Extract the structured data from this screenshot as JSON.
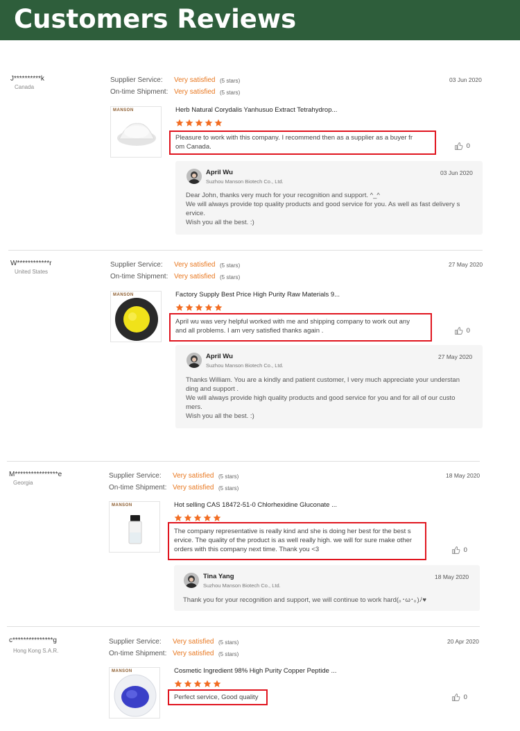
{
  "banner": {
    "title": "Customers Reviews"
  },
  "labels": {
    "supplier_service": "Supplier Service:",
    "ontime_shipment": "On-time Shipment:"
  },
  "colors": {
    "banner_bg": "#2e5e3b",
    "satisfied": "#e8771f",
    "star": "#f26c21",
    "highlight_box": "#e0141e"
  },
  "reviews": [
    {
      "reviewer": "J**********k",
      "country": "Canada",
      "supplier_service": "Very satisfied",
      "supplier_stars": "(5 stars)",
      "ontime_shipment": "Very satisfied",
      "ontime_stars": "(5 stars)",
      "date": "03 Jun 2020",
      "brand": "MANSON",
      "product_title": "Herb Natural Corydalis Yanhusuo Extract Tetrahydrop...",
      "rating": 5,
      "comment_lines": [
        "Pleasure to work with this company.  I recommend then as a supplier as a buyer fr",
        "om Canada."
      ],
      "likes": "0",
      "reply": {
        "name": "April Wu",
        "company": "Suzhou Manson Biotech Co., Ltd.",
        "date": "03 Jun 2020",
        "lines": [
          "Dear John, thanks very much for your recognition and support. ^_^",
          "We will always provide top quality products and good service for you. As well as fast delivery s",
          "ervice.",
          "Wish you all the best. :)"
        ]
      }
    },
    {
      "reviewer": "W************r",
      "country": "United States",
      "supplier_service": "Very satisfied",
      "supplier_stars": "(5 stars)",
      "ontime_shipment": "Very satisfied",
      "ontime_stars": "(5 stars)",
      "date": "27 May 2020",
      "brand": "MANSON",
      "product_title": "Factory Supply Best Price High Purity Raw Materials 9...",
      "rating": 5,
      "comment_lines": [
        "April wu was very helpful worked with me and shipping company to work out any",
        "and all problems.  I am very satisfied  thanks again ."
      ],
      "likes": "0",
      "reply": {
        "name": "April Wu",
        "company": "Suzhou Manson Biotech Co., Ltd.",
        "date": "27 May 2020",
        "lines": [
          "Thanks William. You are a kindly and patient customer, I very much appreciate your understan",
          "ding and support .",
          "We will always provide high quality products and good service for you and for all of our custo",
          "mers.",
          "Wish you all the best. :)"
        ]
      }
    },
    {
      "reviewer": "M****************e",
      "country": "Georgia",
      "supplier_service": "Very satisfied",
      "supplier_stars": "(5 stars)",
      "ontime_shipment": "Very satisfied",
      "ontime_stars": "(5 stars)",
      "date": "18 May 2020",
      "brand": "MANSON",
      "product_title": "Hot selling CAS 18472-51-0 Chlorhexidine Gluconate ...",
      "rating": 5,
      "comment_lines": [
        "The company representative is really kind and she is doing her best for the best s",
        "ervice. The quality of the product is as well really high. we will for sure make other",
        "orders with this company next time. Thank you <3"
      ],
      "likes": "0",
      "reply": {
        "name": "Tina Yang",
        "company": "Suzhou Manson Biotech Co., Ltd.",
        "date": "18 May 2020",
        "lines": [
          "Thank you for your recognition and support, we will continue to work hard(｡･ω･｡)ﾉ♥"
        ]
      }
    },
    {
      "reviewer": "c***************g",
      "country": "Hong Kong S.A.R.",
      "supplier_service": "Very satisfied",
      "supplier_stars": "(5 stars)",
      "ontime_shipment": "Very satisfied",
      "ontime_stars": "(5 stars)",
      "date": "20 Apr 2020",
      "brand": "MANSON",
      "product_title": "Cosmetic Ingredient 98% High Purity Copper Peptide ...",
      "rating": 5,
      "comment_lines": [
        "Perfect service, Good quality"
      ],
      "likes": "0"
    }
  ]
}
